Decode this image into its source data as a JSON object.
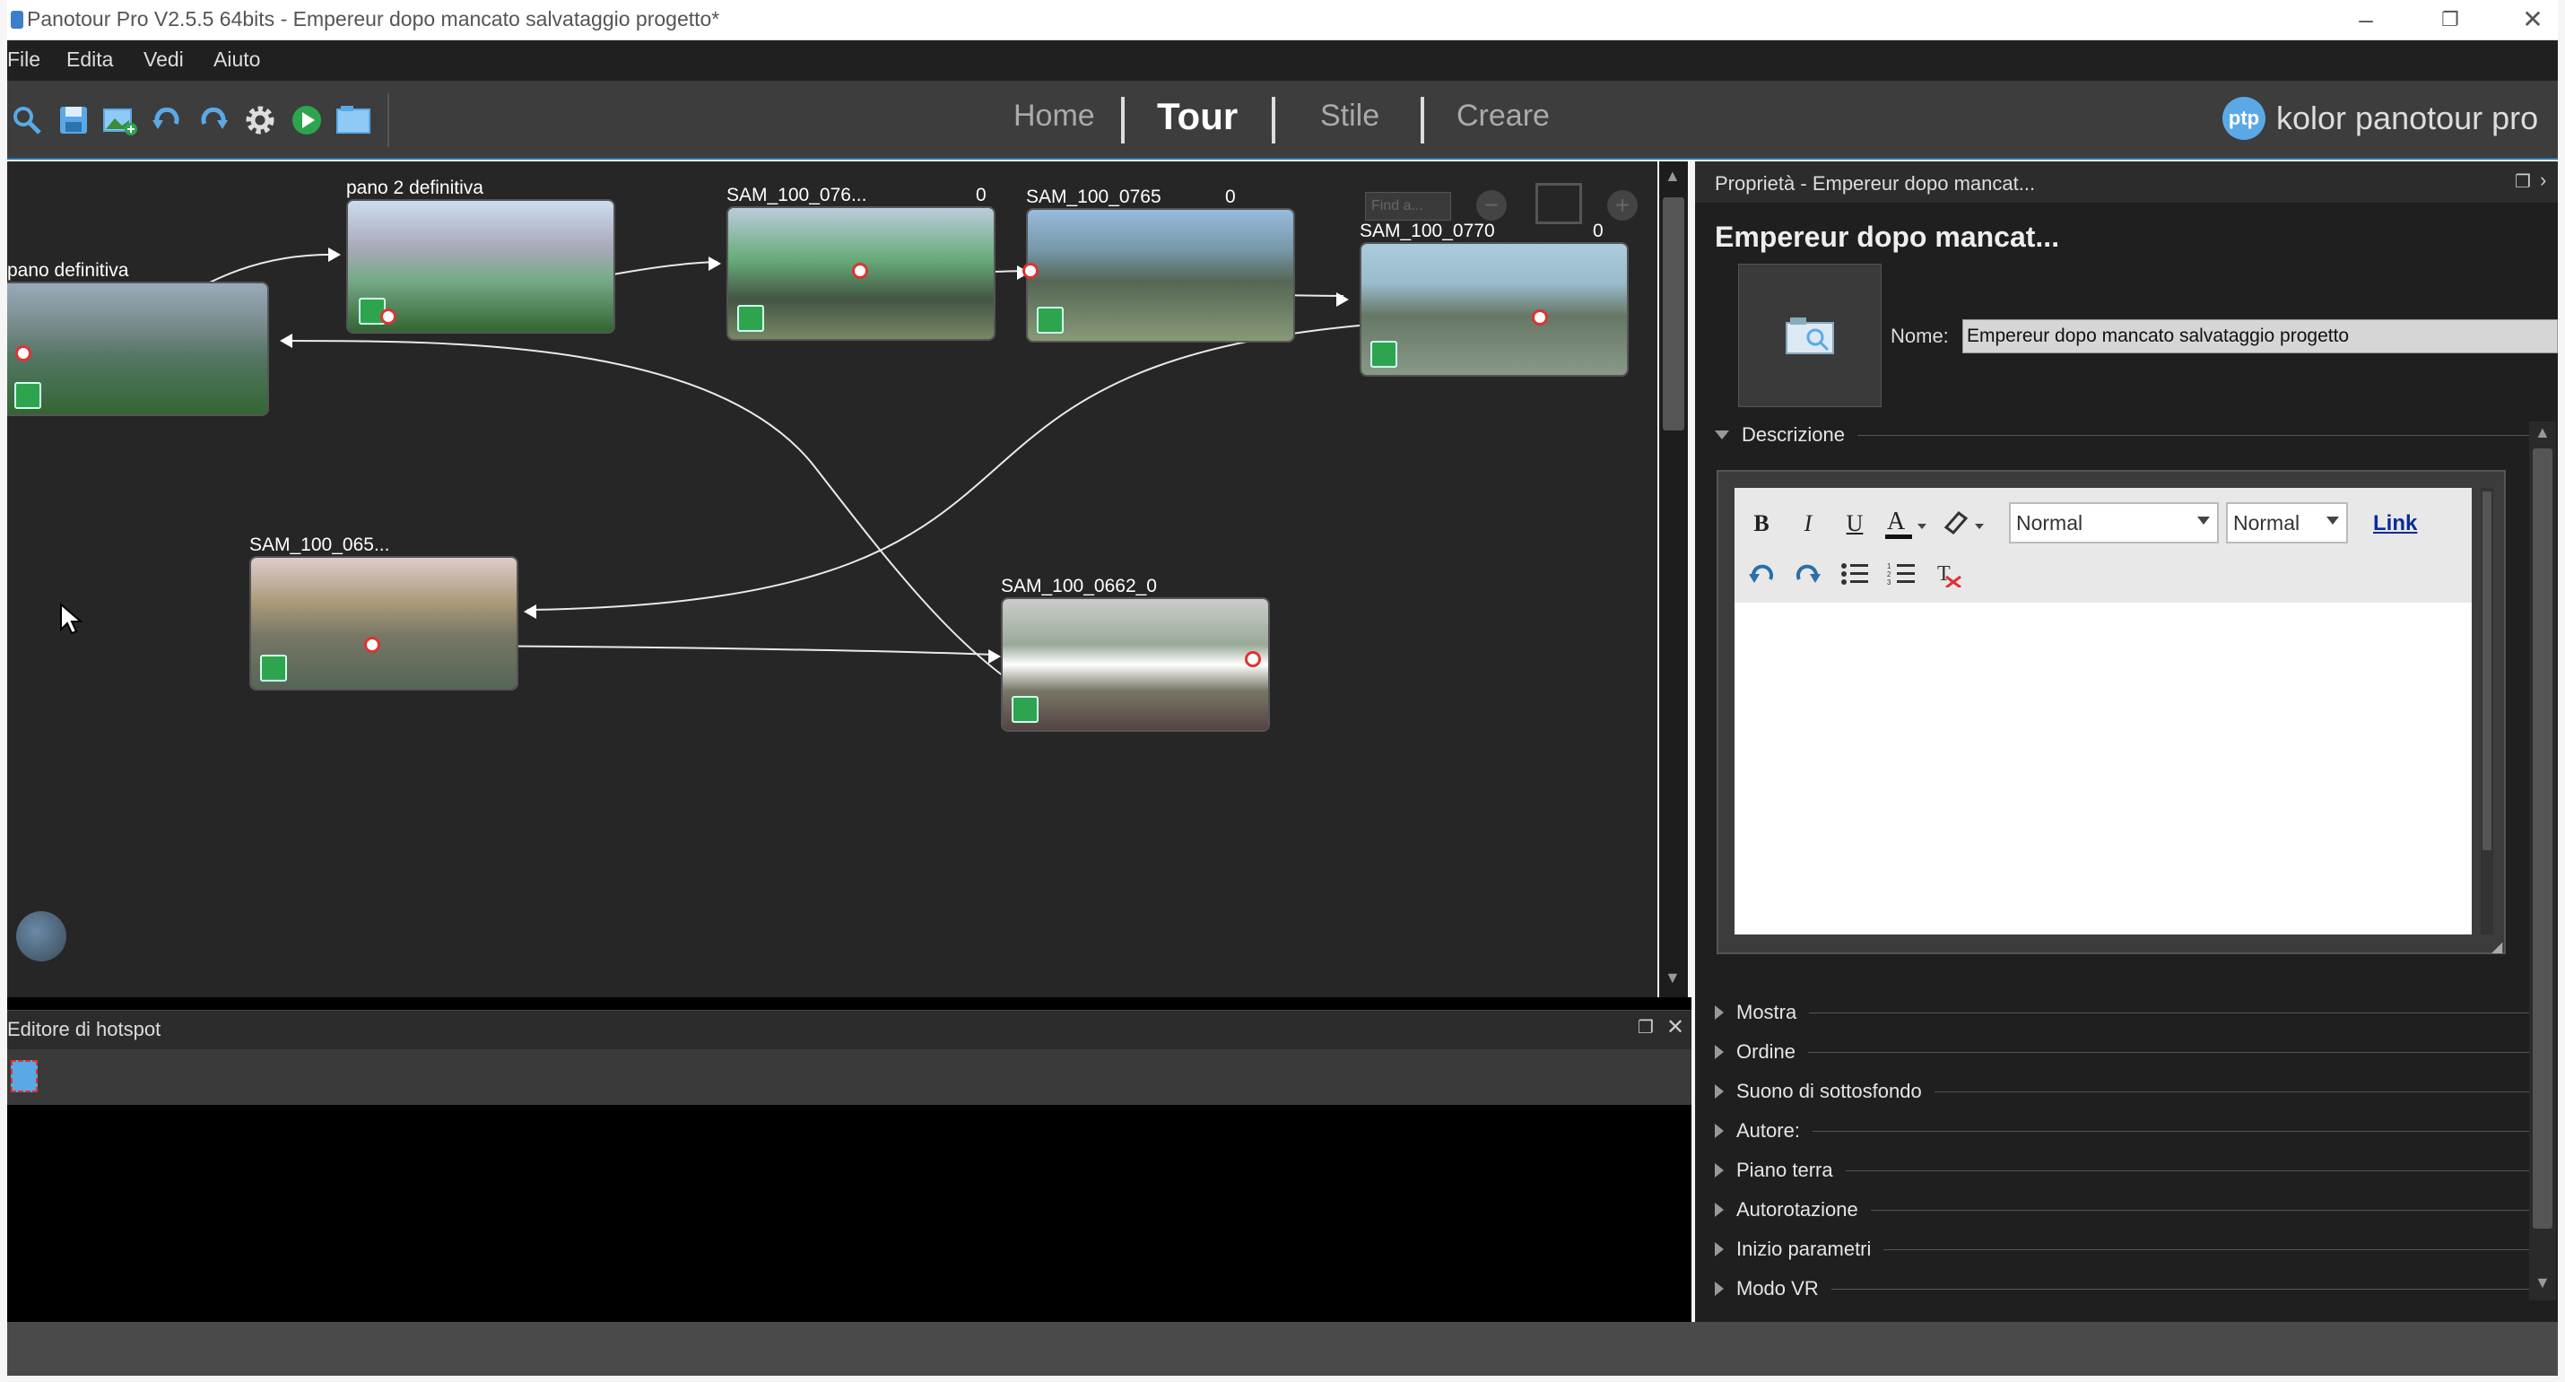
{
  "window": {
    "title": "Panotour Pro V2.5.5 64bits - Empereur dopo mancato salvataggio progetto*"
  },
  "menu": {
    "items": [
      "File",
      "Edita",
      "Vedi",
      "Aiuto"
    ]
  },
  "toolbar": {
    "icons": [
      "search-icon",
      "save-icon",
      "add-panorama-icon",
      "undo-icon",
      "redo-icon",
      "settings-icon",
      "play-icon",
      "folder-icon"
    ],
    "tabs": [
      {
        "label": "Home",
        "active": false
      },
      {
        "label": "Tour",
        "active": true
      },
      {
        "label": "Stile",
        "active": false
      },
      {
        "label": "Creare",
        "active": false
      }
    ],
    "brand_logo": "ptp",
    "brand": "kolor panotour pro"
  },
  "graph": {
    "find_placeholder": "Find a...",
    "nodes": [
      {
        "title": "pano definitiva"
      },
      {
        "title": "pano 2 definitiva"
      },
      {
        "title": "SAM_100_076...",
        "count": "0"
      },
      {
        "title": "SAM_100_0765",
        "count": "0"
      },
      {
        "title": "SAM_100_0770",
        "count": "0"
      },
      {
        "title": "SAM_100_065..."
      },
      {
        "title": "SAM_100_0662_0"
      }
    ]
  },
  "hotspot_editor": {
    "title": "Editore di hotspot"
  },
  "properties": {
    "panel_title": "Proprietà - Empereur dopo mancat...",
    "heading": "Empereur dopo mancat...",
    "name_label": "Nome:",
    "name_value": "Empereur dopo mancato salvataggio progetto",
    "description_label": "Descrizione",
    "editor": {
      "bold": "B",
      "italic": "I",
      "underline": "U",
      "format_value": "Normal",
      "size_value": "Normal",
      "link": "Link"
    },
    "sections": [
      "Mostra",
      "Ordine",
      "Suono di sottosfondo",
      "Autore:",
      "Piano terra",
      "Autorotazione",
      "Inizio parametri",
      "Modo VR"
    ]
  },
  "colors": {
    "accent": "#2a6fa8",
    "hotspot": "#d33333",
    "badge": "#2ea44f"
  }
}
